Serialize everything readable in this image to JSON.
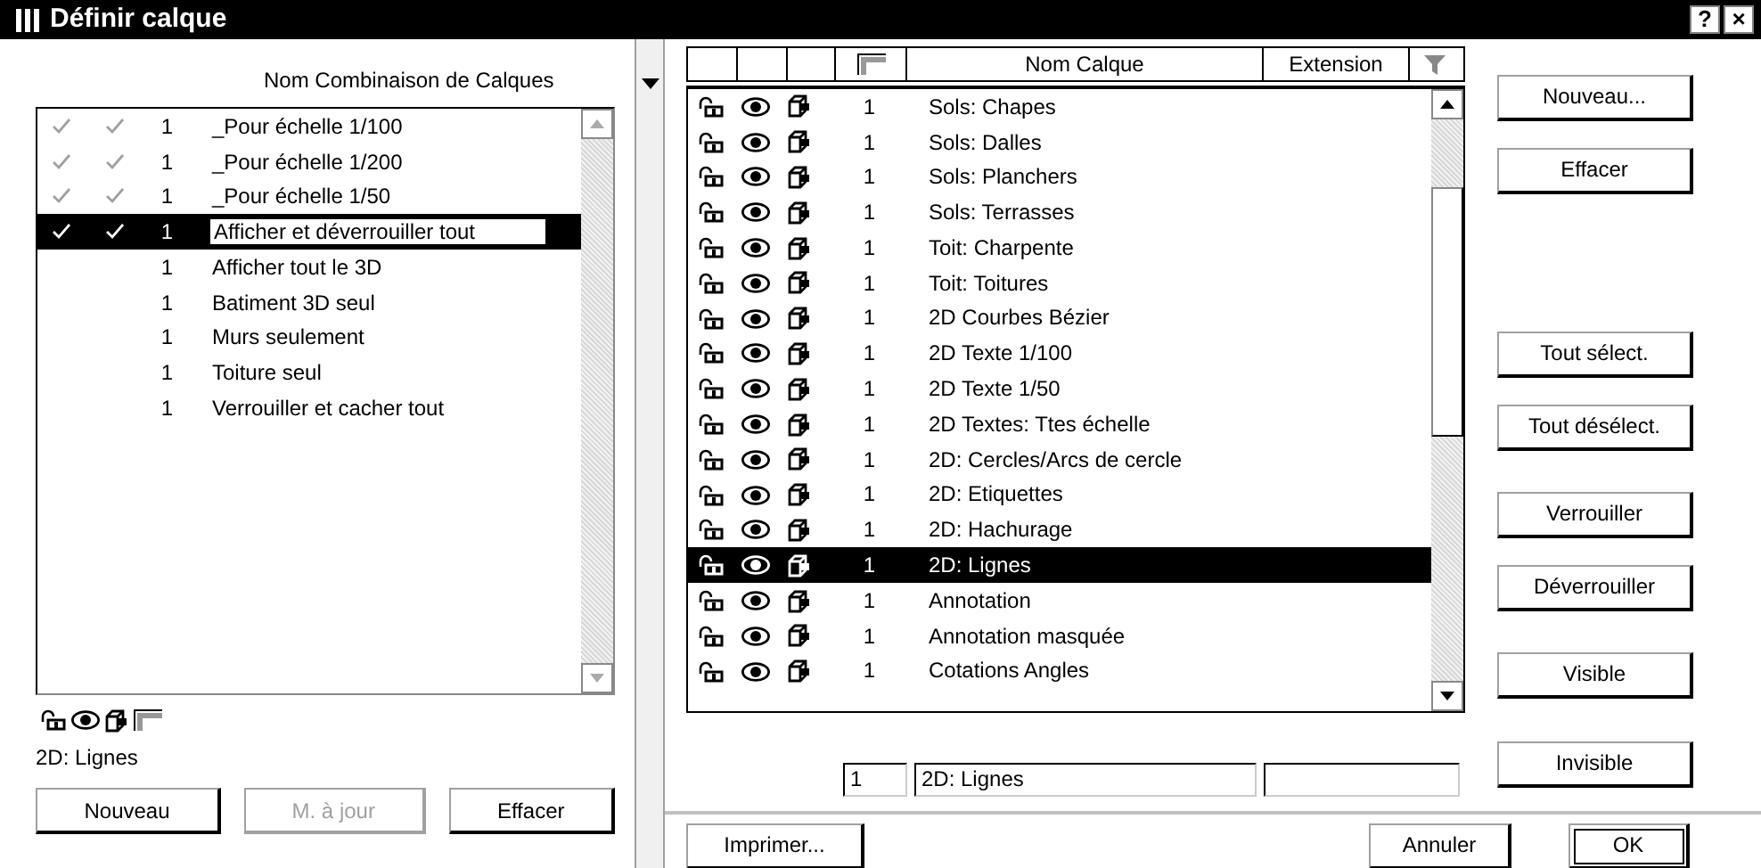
{
  "window": {
    "title": "Définir calque",
    "help_button": "?",
    "close_button": "×"
  },
  "combinations": {
    "header": "Nom Combinaison de Calques",
    "items": [
      {
        "check_1": true,
        "check_2": true,
        "number": "1",
        "name": "_Pour échelle 1/100",
        "selected": false
      },
      {
        "check_1": true,
        "check_2": true,
        "number": "1",
        "name": "_Pour échelle 1/200",
        "selected": false
      },
      {
        "check_1": true,
        "check_2": true,
        "number": "1",
        "name": "_Pour échelle 1/50",
        "selected": false
      },
      {
        "check_1": true,
        "check_2": true,
        "number": "1",
        "name": "Afficher et déverrouiller tout",
        "selected": true
      },
      {
        "check_1": false,
        "check_2": false,
        "number": "1",
        "name": "Afficher tout le 3D",
        "selected": false
      },
      {
        "check_1": false,
        "check_2": false,
        "number": "1",
        "name": "Batiment 3D seul",
        "selected": false
      },
      {
        "check_1": false,
        "check_2": false,
        "number": "1",
        "name": "Murs seulement",
        "selected": false
      },
      {
        "check_1": false,
        "check_2": false,
        "number": "1",
        "name": "Toiture seul",
        "selected": false
      },
      {
        "check_1": false,
        "check_2": false,
        "number": "1",
        "name": "Verrouiller et cacher tout",
        "selected": false
      }
    ]
  },
  "legend": {
    "caption": "2D: Lignes"
  },
  "left_buttons": [
    {
      "label": "Nouveau",
      "disabled": false
    },
    {
      "label": "M. à jour",
      "disabled": true
    },
    {
      "label": "Effacer",
      "disabled": false
    }
  ],
  "layers": {
    "columns": [
      {
        "kind": "blank"
      },
      {
        "kind": "blank"
      },
      {
        "kind": "blank"
      },
      {
        "kind": "hatch"
      },
      {
        "kind": "text",
        "label": "Nom Calque"
      },
      {
        "kind": "text",
        "label": "Extension"
      },
      {
        "kind": "filter"
      }
    ],
    "rows": [
      {
        "number": "1",
        "name": "Sols: Chapes",
        "selected": false
      },
      {
        "number": "1",
        "name": "Sols: Dalles",
        "selected": false
      },
      {
        "number": "1",
        "name": "Sols: Planchers",
        "selected": false
      },
      {
        "number": "1",
        "name": "Sols: Terrasses",
        "selected": false
      },
      {
        "number": "1",
        "name": "Toit: Charpente",
        "selected": false
      },
      {
        "number": "1",
        "name": "Toit: Toitures",
        "selected": false
      },
      {
        "number": "1",
        "name": "2D Courbes Bézier",
        "selected": false
      },
      {
        "number": "1",
        "name": "2D Texte 1/100",
        "selected": false
      },
      {
        "number": "1",
        "name": "2D Texte 1/50",
        "selected": false
      },
      {
        "number": "1",
        "name": "2D Textes: Ttes échelle",
        "selected": false
      },
      {
        "number": "1",
        "name": "2D: Cercles/Arcs de cercle",
        "selected": false
      },
      {
        "number": "1",
        "name": "2D: Etiquettes",
        "selected": false
      },
      {
        "number": "1",
        "name": "2D: Hachurage",
        "selected": false
      },
      {
        "number": "1",
        "name": "2D: Lignes",
        "selected": true
      },
      {
        "number": "1",
        "name": "Annotation",
        "selected": false
      },
      {
        "number": "1",
        "name": "Annotation masquée",
        "selected": false
      },
      {
        "number": "1",
        "name": "Cotations Angles",
        "selected": false
      }
    ]
  },
  "edit_fields": {
    "number": "1",
    "name": "2D: Lignes"
  },
  "side_buttons": [
    {
      "label": "Nouveau..."
    },
    {
      "label": "Effacer"
    },
    {
      "label": "Tout sélect."
    },
    {
      "label": "Tout désélect."
    },
    {
      "label": "Verrouiller"
    },
    {
      "label": "Déverrouiller"
    },
    {
      "label": "Visible"
    },
    {
      "label": "Invisible"
    }
  ],
  "footer_buttons": [
    {
      "label": "Imprimer...",
      "default": false
    },
    {
      "label": "Annuler",
      "default": false
    },
    {
      "label": "OK",
      "default": true
    }
  ]
}
